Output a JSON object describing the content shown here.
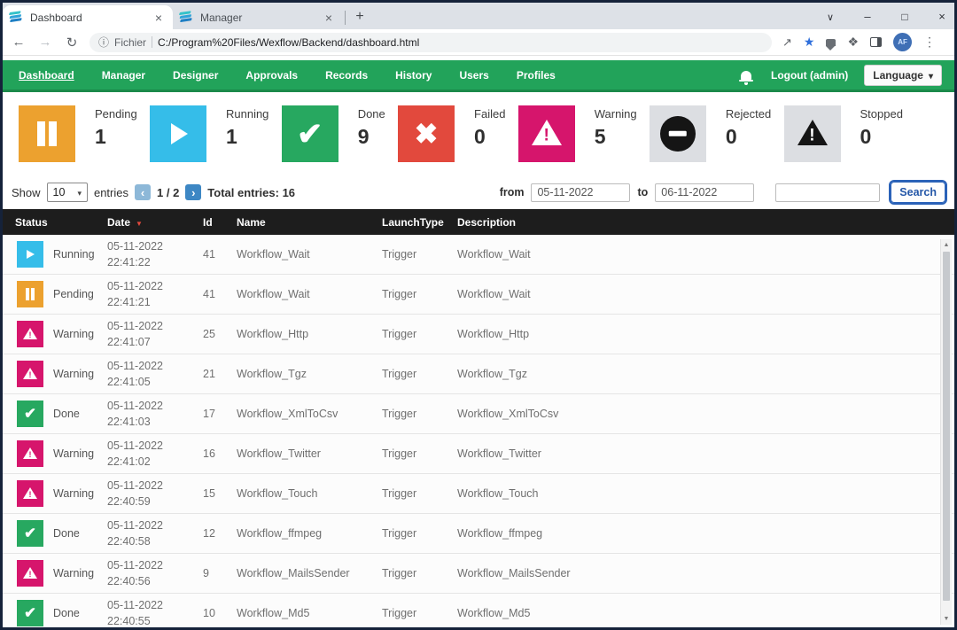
{
  "theme": {
    "navbar_green": "#22a35a",
    "navbar_green_dark": "#1b8a4b",
    "table_header_dark": "#1d1d1d",
    "link_blue": "#2457a8"
  },
  "browser": {
    "tabs": [
      {
        "title": "Dashboard",
        "active": true
      },
      {
        "title": "Manager",
        "active": false
      }
    ],
    "address": {
      "scheme_label": "Fichier",
      "url": "C:/Program%20Files/Wexflow/Backend/dashboard.html"
    },
    "profile_initials": "AF"
  },
  "navbar": {
    "items": [
      {
        "label": "Dashboard",
        "active": true
      },
      {
        "label": "Manager",
        "active": false
      },
      {
        "label": "Designer",
        "active": false
      },
      {
        "label": "Approvals",
        "active": false
      },
      {
        "label": "Records",
        "active": false
      },
      {
        "label": "History",
        "active": false
      },
      {
        "label": "Users",
        "active": false
      },
      {
        "label": "Profiles",
        "active": false
      }
    ],
    "logout_label": "Logout (admin)",
    "language_label": "Language"
  },
  "cards": [
    {
      "label": "Pending",
      "count": "1",
      "icon": "pause",
      "color": "#eca12f"
    },
    {
      "label": "Running",
      "count": "1",
      "icon": "play",
      "color": "#35bde9"
    },
    {
      "label": "Done",
      "count": "9",
      "icon": "check",
      "color": "#27a860"
    },
    {
      "label": "Failed",
      "count": "0",
      "icon": "x",
      "color": "#e2493d"
    },
    {
      "label": "Warning",
      "count": "5",
      "icon": "warning",
      "color": "#d6156c"
    },
    {
      "label": "Rejected",
      "count": "0",
      "icon": "minus",
      "color": "#dcdee2"
    },
    {
      "label": "Stopped",
      "count": "0",
      "icon": "warning-black",
      "color": "#dcdee2"
    }
  ],
  "controls": {
    "show_label": "Show",
    "page_size": "10",
    "entries_label": "entries",
    "page_indicator": "1 / 2",
    "total_label": "Total entries: 16",
    "from_label": "from",
    "from_value": "05-11-2022",
    "to_label": "to",
    "to_value": "06-11-2022",
    "search_value": "",
    "search_label": "Search"
  },
  "table": {
    "columns": [
      "Status",
      "Date",
      "Id",
      "Name",
      "LaunchType",
      "Description"
    ],
    "sorted_column": "Date",
    "rows": [
      {
        "status": "Running",
        "icon": "play",
        "color": "#35bde9",
        "date": "05-11-2022",
        "time": "22:41:22",
        "id": "41",
        "name": "Workflow_Wait",
        "launch_type": "Trigger",
        "description": "Workflow_Wait"
      },
      {
        "status": "Pending",
        "icon": "pause",
        "color": "#eca12f",
        "date": "05-11-2022",
        "time": "22:41:21",
        "id": "41",
        "name": "Workflow_Wait",
        "launch_type": "Trigger",
        "description": "Workflow_Wait"
      },
      {
        "status": "Warning",
        "icon": "warning",
        "color": "#d6156c",
        "date": "05-11-2022",
        "time": "22:41:07",
        "id": "25",
        "name": "Workflow_Http",
        "launch_type": "Trigger",
        "description": "Workflow_Http"
      },
      {
        "status": "Warning",
        "icon": "warning",
        "color": "#d6156c",
        "date": "05-11-2022",
        "time": "22:41:05",
        "id": "21",
        "name": "Workflow_Tgz",
        "launch_type": "Trigger",
        "description": "Workflow_Tgz"
      },
      {
        "status": "Done",
        "icon": "check",
        "color": "#27a860",
        "date": "05-11-2022",
        "time": "22:41:03",
        "id": "17",
        "name": "Workflow_XmlToCsv",
        "launch_type": "Trigger",
        "description": "Workflow_XmlToCsv"
      },
      {
        "status": "Warning",
        "icon": "warning",
        "color": "#d6156c",
        "date": "05-11-2022",
        "time": "22:41:02",
        "id": "16",
        "name": "Workflow_Twitter",
        "launch_type": "Trigger",
        "description": "Workflow_Twitter"
      },
      {
        "status": "Warning",
        "icon": "warning",
        "color": "#d6156c",
        "date": "05-11-2022",
        "time": "22:40:59",
        "id": "15",
        "name": "Workflow_Touch",
        "launch_type": "Trigger",
        "description": "Workflow_Touch"
      },
      {
        "status": "Done",
        "icon": "check",
        "color": "#27a860",
        "date": "05-11-2022",
        "time": "22:40:58",
        "id": "12",
        "name": "Workflow_ffmpeg",
        "launch_type": "Trigger",
        "description": "Workflow_ffmpeg"
      },
      {
        "status": "Warning",
        "icon": "warning",
        "color": "#d6156c",
        "date": "05-11-2022",
        "time": "22:40:56",
        "id": "9",
        "name": "Workflow_MailsSender",
        "launch_type": "Trigger",
        "description": "Workflow_MailsSender"
      },
      {
        "status": "Done",
        "icon": "check",
        "color": "#27a860",
        "date": "05-11-2022",
        "time": "22:40:55",
        "id": "10",
        "name": "Workflow_Md5",
        "launch_type": "Trigger",
        "description": "Workflow_Md5"
      }
    ]
  }
}
